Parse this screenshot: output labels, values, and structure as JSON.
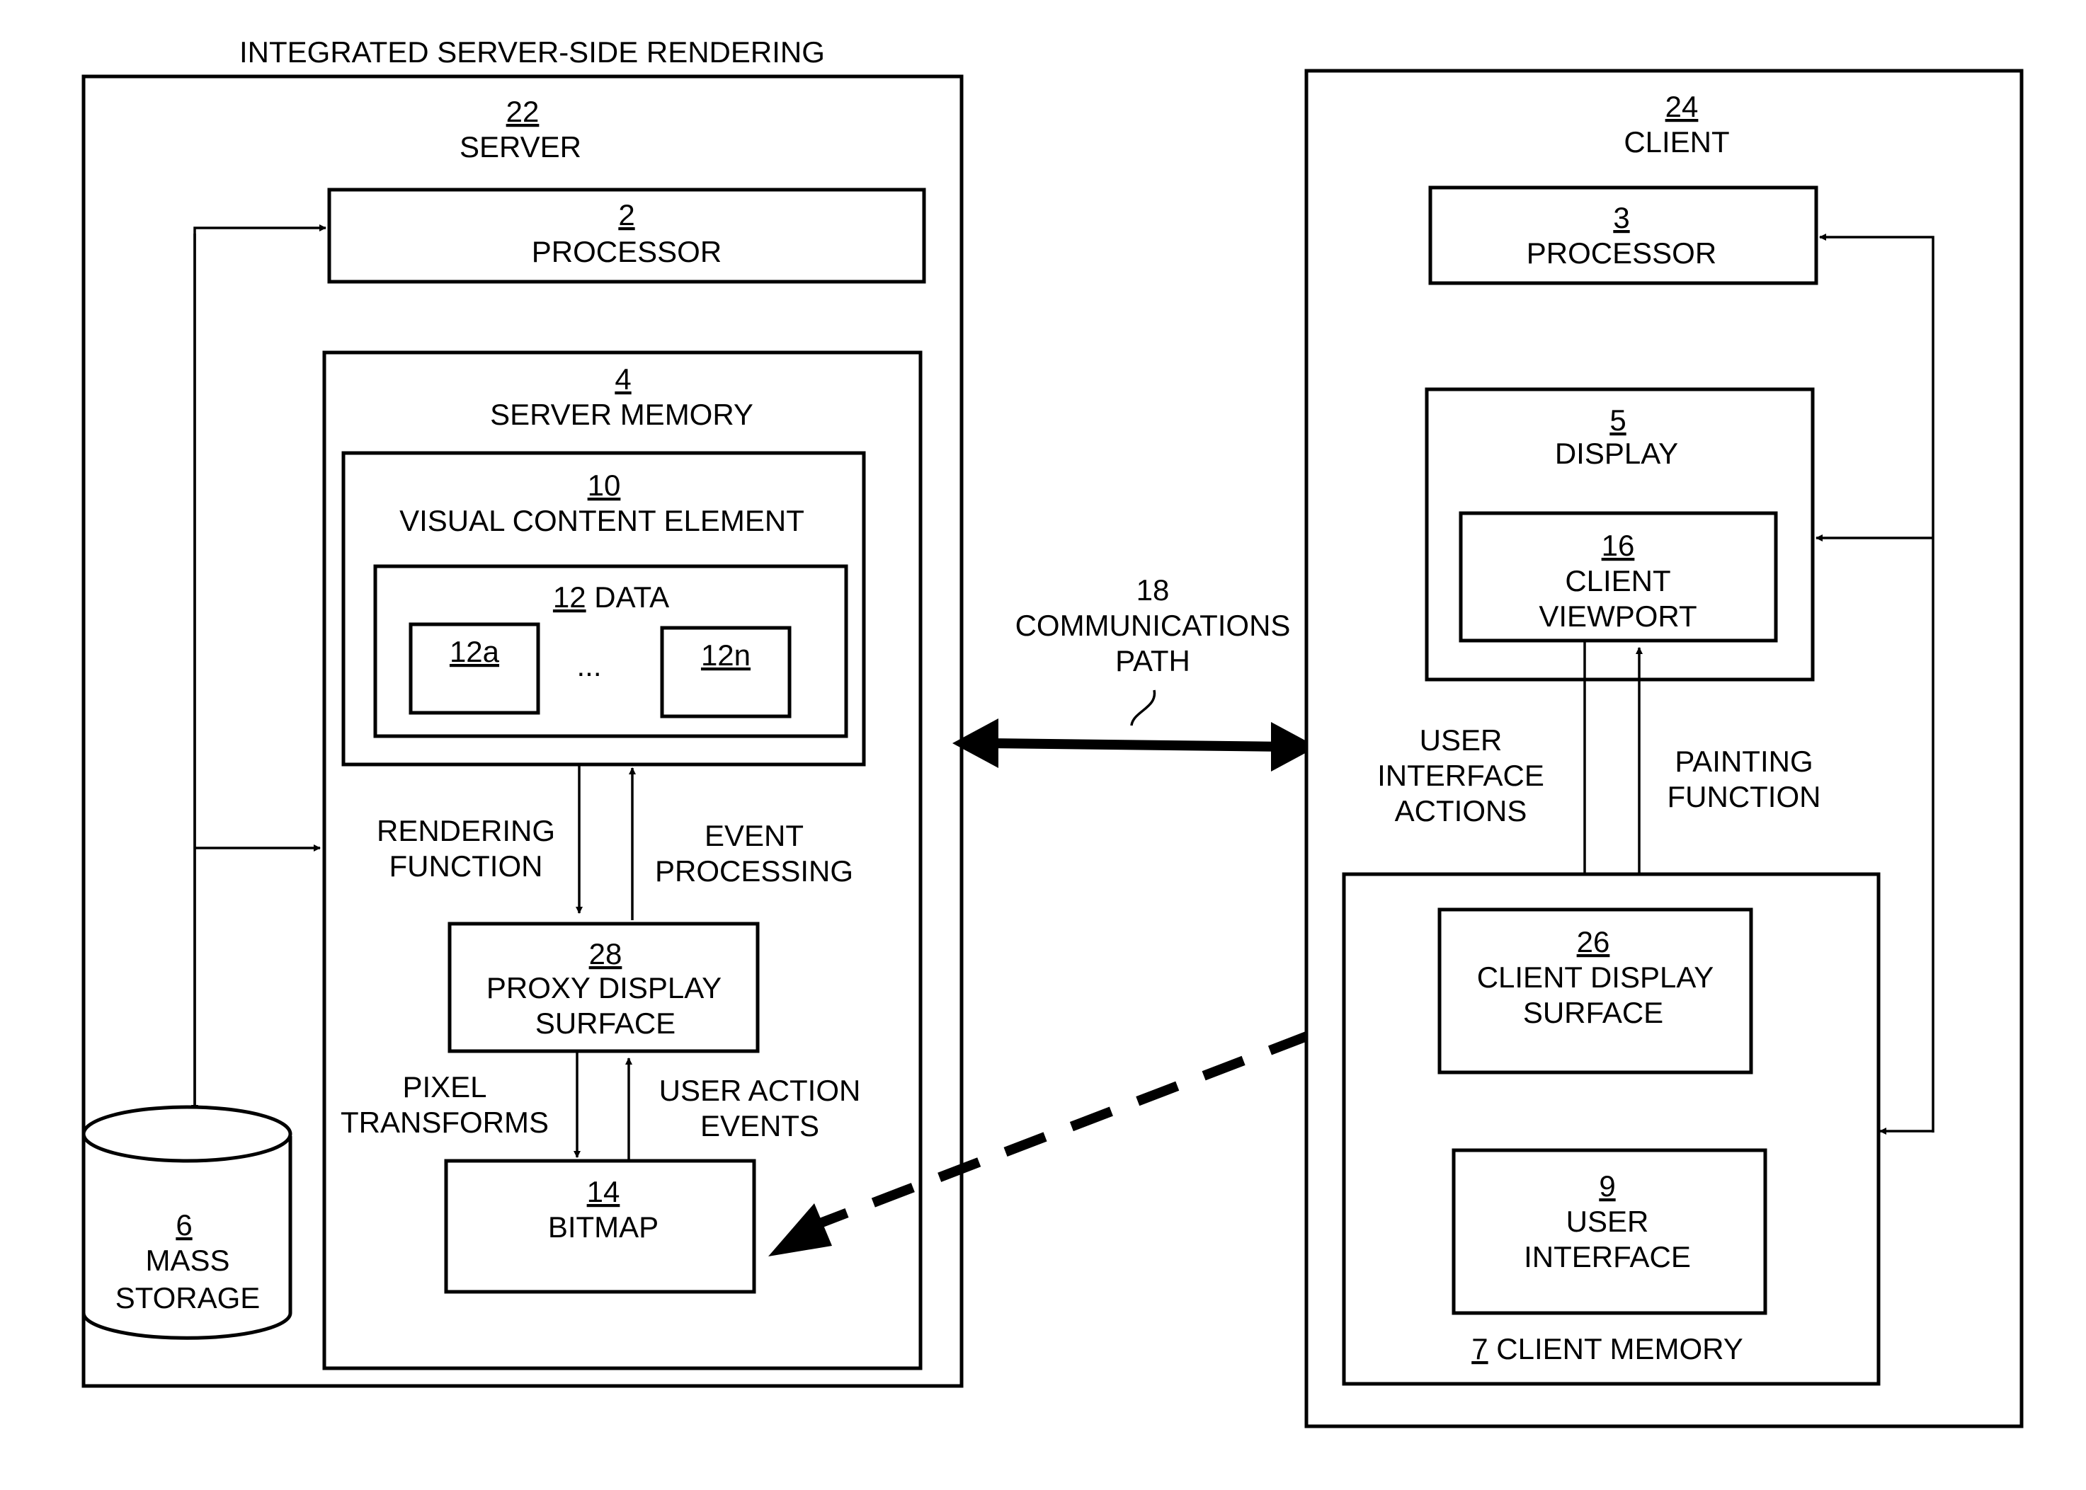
{
  "title": "INTEGRATED SERVER-SIDE RENDERING",
  "server": {
    "ref": "22",
    "label": "SERVER",
    "processor": {
      "ref": "2",
      "label": "PROCESSOR"
    },
    "memory": {
      "ref": "4",
      "label": "SERVER MEMORY"
    },
    "visual_content_element": {
      "ref": "10",
      "label": "VISUAL CONTENT ELEMENT"
    },
    "data": {
      "ref": "12",
      "label": "DATA",
      "items": [
        "12a",
        "12n"
      ],
      "ellipsis": "..."
    },
    "proxy_display_surface": {
      "ref": "28",
      "label_line1": "PROXY DISPLAY",
      "label_line2": "SURFACE"
    },
    "bitmap": {
      "ref": "14",
      "label": "BITMAP"
    },
    "mass_storage": {
      "ref": "6",
      "label_line1": "MASS",
      "label_line2": "STORAGE"
    },
    "rendering_function": [
      "RENDERING",
      "FUNCTION"
    ],
    "event_processing": [
      "EVENT",
      "PROCESSING"
    ],
    "pixel_transforms": [
      "PIXEL",
      "TRANSFORMS"
    ],
    "user_action_events": [
      "USER ACTION",
      "EVENTS"
    ]
  },
  "communications_path": {
    "ref": "18",
    "label_line1": "COMMUNICATIONS",
    "label_line2": "PATH"
  },
  "client": {
    "ref": "24",
    "label": "CLIENT",
    "processor": {
      "ref": "3",
      "label": "PROCESSOR"
    },
    "display": {
      "ref": "5",
      "label": "DISPLAY"
    },
    "viewport": {
      "ref": "16",
      "label_line1": "CLIENT",
      "label_line2": "VIEWPORT"
    },
    "display_surface": {
      "ref": "26",
      "label_line1": "CLIENT DISPLAY",
      "label_line2": "SURFACE"
    },
    "user_interface": {
      "ref": "9",
      "label_line1": "USER",
      "label_line2": "INTERFACE"
    },
    "memory": {
      "ref": "7",
      "label": "CLIENT MEMORY"
    },
    "ui_actions": [
      "USER",
      "INTERFACE",
      "ACTIONS"
    ],
    "painting_function": [
      "PAINTING",
      "FUNCTION"
    ]
  }
}
